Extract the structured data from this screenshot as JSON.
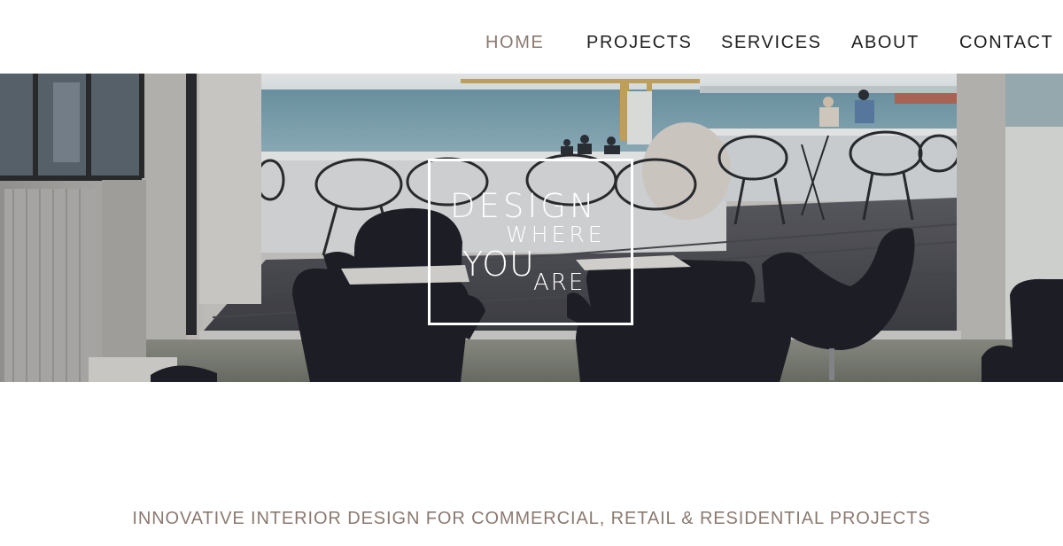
{
  "nav": {
    "items": [
      {
        "label": "HOME",
        "active": true
      },
      {
        "label": "PROJECTS",
        "active": false
      },
      {
        "label": "SERVICES",
        "active": false
      },
      {
        "label": "ABOUT",
        "active": false
      },
      {
        "label": "CONTACT",
        "active": false
      }
    ],
    "active_color": "#8a7a70",
    "text_color": "#1f1f1f"
  },
  "hero": {
    "logo": {
      "line1": "DESIGN",
      "line2": "WHERE",
      "line3": "YOU",
      "line4": "ARE"
    }
  },
  "tagline": "INNOVATIVE INTERIOR DESIGN FOR COMMERCIAL, RETAIL & RESIDENTIAL PROJECTS"
}
